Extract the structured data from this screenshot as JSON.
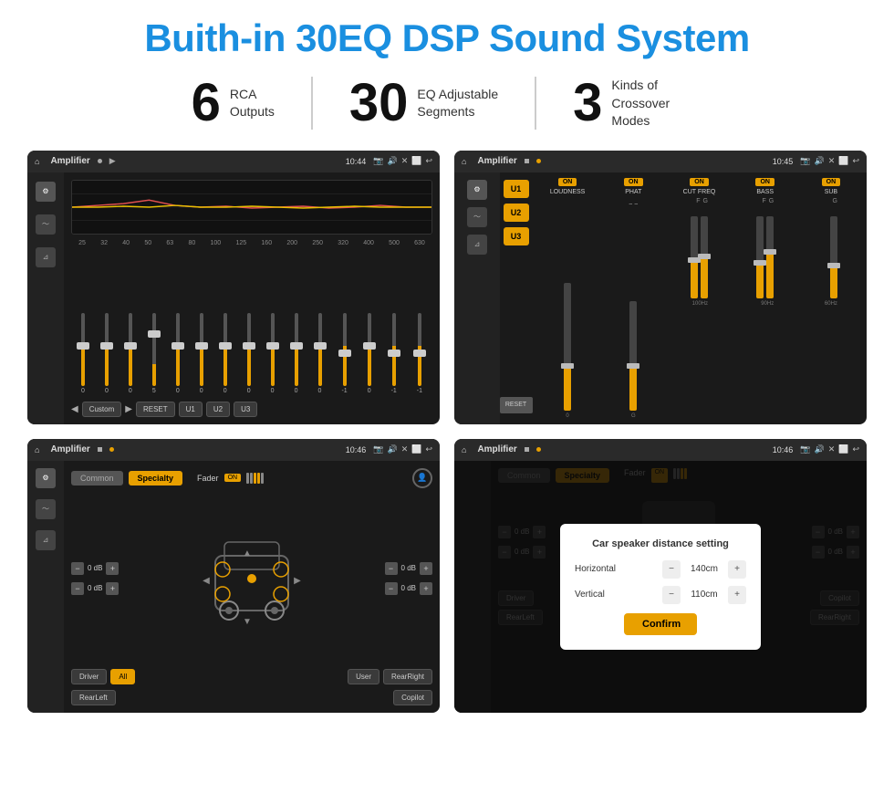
{
  "header": {
    "title": "Buith-in 30EQ DSP Sound System"
  },
  "stats": [
    {
      "number": "6",
      "label_line1": "RCA",
      "label_line2": "Outputs"
    },
    {
      "number": "30",
      "label_line1": "EQ Adjustable",
      "label_line2": "Segments"
    },
    {
      "number": "3",
      "label_line1": "Kinds of",
      "label_line2": "Crossover Modes"
    }
  ],
  "screens": [
    {
      "id": "screen1",
      "topbar": {
        "title": "Amplifier",
        "time": "10:44"
      },
      "type": "eq",
      "freqs": [
        "25",
        "32",
        "40",
        "50",
        "63",
        "80",
        "100",
        "125",
        "160",
        "200",
        "250",
        "320",
        "400",
        "500",
        "630"
      ],
      "values": [
        "0",
        "0",
        "0",
        "5",
        "0",
        "0",
        "0",
        "0",
        "0",
        "0",
        "0",
        "-1",
        "0",
        "-1"
      ],
      "bottom_btns": [
        "Custom",
        "RESET",
        "U1",
        "U2",
        "U3"
      ]
    },
    {
      "id": "screen2",
      "topbar": {
        "title": "Amplifier",
        "time": "10:45"
      },
      "type": "amplifier",
      "channels": [
        {
          "name": "LOUDNESS",
          "on": true
        },
        {
          "name": "PHAT",
          "on": true
        },
        {
          "name": "CUT FREQ",
          "on": true
        },
        {
          "name": "BASS",
          "on": true
        },
        {
          "name": "SUB",
          "on": true
        }
      ],
      "u_buttons": [
        "U1",
        "U2",
        "U3"
      ],
      "reset_label": "RESET"
    },
    {
      "id": "screen3",
      "topbar": {
        "title": "Amplifier",
        "time": "10:46"
      },
      "type": "specialty",
      "tabs": [
        "Common",
        "Specialty"
      ],
      "active_tab": "Specialty",
      "fader_label": "Fader",
      "fader_on": true,
      "db_values": [
        "0 dB",
        "0 dB",
        "0 dB",
        "0 dB"
      ],
      "bottom_btns": [
        "Driver",
        "All",
        "User",
        "RearLeft",
        "RearRight",
        "Copilot"
      ]
    },
    {
      "id": "screen4",
      "topbar": {
        "title": "Amplifier",
        "time": "10:46"
      },
      "type": "dialog",
      "tabs": [
        "Common",
        "Specialty"
      ],
      "active_tab": "Specialty",
      "dialog": {
        "title": "Car speaker distance setting",
        "fields": [
          {
            "label": "Horizontal",
            "value": "140cm"
          },
          {
            "label": "Vertical",
            "value": "110cm"
          }
        ],
        "confirm_label": "Confirm"
      },
      "bottom_btns": [
        "Driver",
        "RearLeft",
        "User",
        "RearRight",
        "Copilot"
      ]
    }
  ]
}
